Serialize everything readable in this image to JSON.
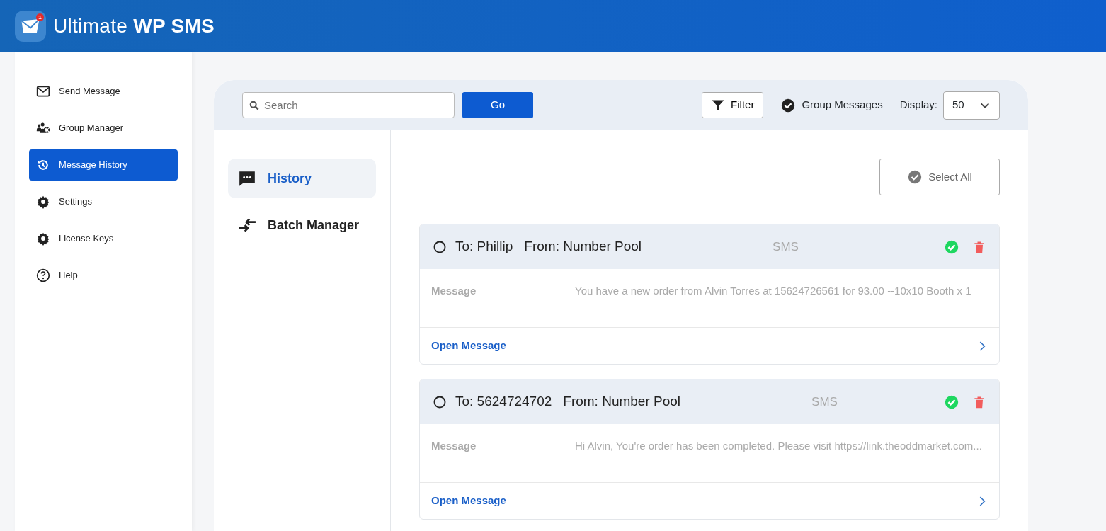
{
  "header": {
    "logo_badge": "1",
    "title_light": "Ultimate",
    "title_bold": "WP SMS"
  },
  "sidebar": {
    "items": [
      {
        "label": "Send Message",
        "kind": "envelope",
        "selected": false
      },
      {
        "label": "Group Manager",
        "kind": "group",
        "selected": false
      },
      {
        "label": "Message History",
        "kind": "history",
        "selected": true
      },
      {
        "label": "Settings",
        "kind": "gear",
        "selected": false
      },
      {
        "label": "License Keys",
        "kind": "gear",
        "selected": false
      },
      {
        "label": "Help",
        "kind": "help",
        "selected": false
      }
    ]
  },
  "toolbar": {
    "search": {
      "placeholder": "Search"
    },
    "go_button": "Go",
    "filter_button": "Filter",
    "group_messages": {
      "label": "Group Messages",
      "checked": true
    },
    "display": {
      "label": "Display:",
      "value": "50"
    }
  },
  "subnav": {
    "items": [
      {
        "label": "History",
        "kind": "chat",
        "selected": true
      },
      {
        "label": "Batch Manager",
        "kind": "batch",
        "selected": false
      }
    ]
  },
  "select_all_button": "Select All",
  "messages": [
    {
      "to": "To: Phillip",
      "from": "From: Number Pool",
      "type": "SMS",
      "selected": false,
      "sent": true,
      "message_label": "Message",
      "text": "You have a new order from Alvin Torres at 15624726561 for 93.00 --10x10 Booth x 1",
      "link": "Open Message"
    },
    {
      "to": "To: 5624724702",
      "from": "From: Number Pool",
      "type": "SMS",
      "selected": false,
      "sent": true,
      "message_label": "Message",
      "text": "Hi Alvin, You're order has been completed. Please visit https://link.theoddmarket.com...",
      "link": "Open Message"
    }
  ]
}
